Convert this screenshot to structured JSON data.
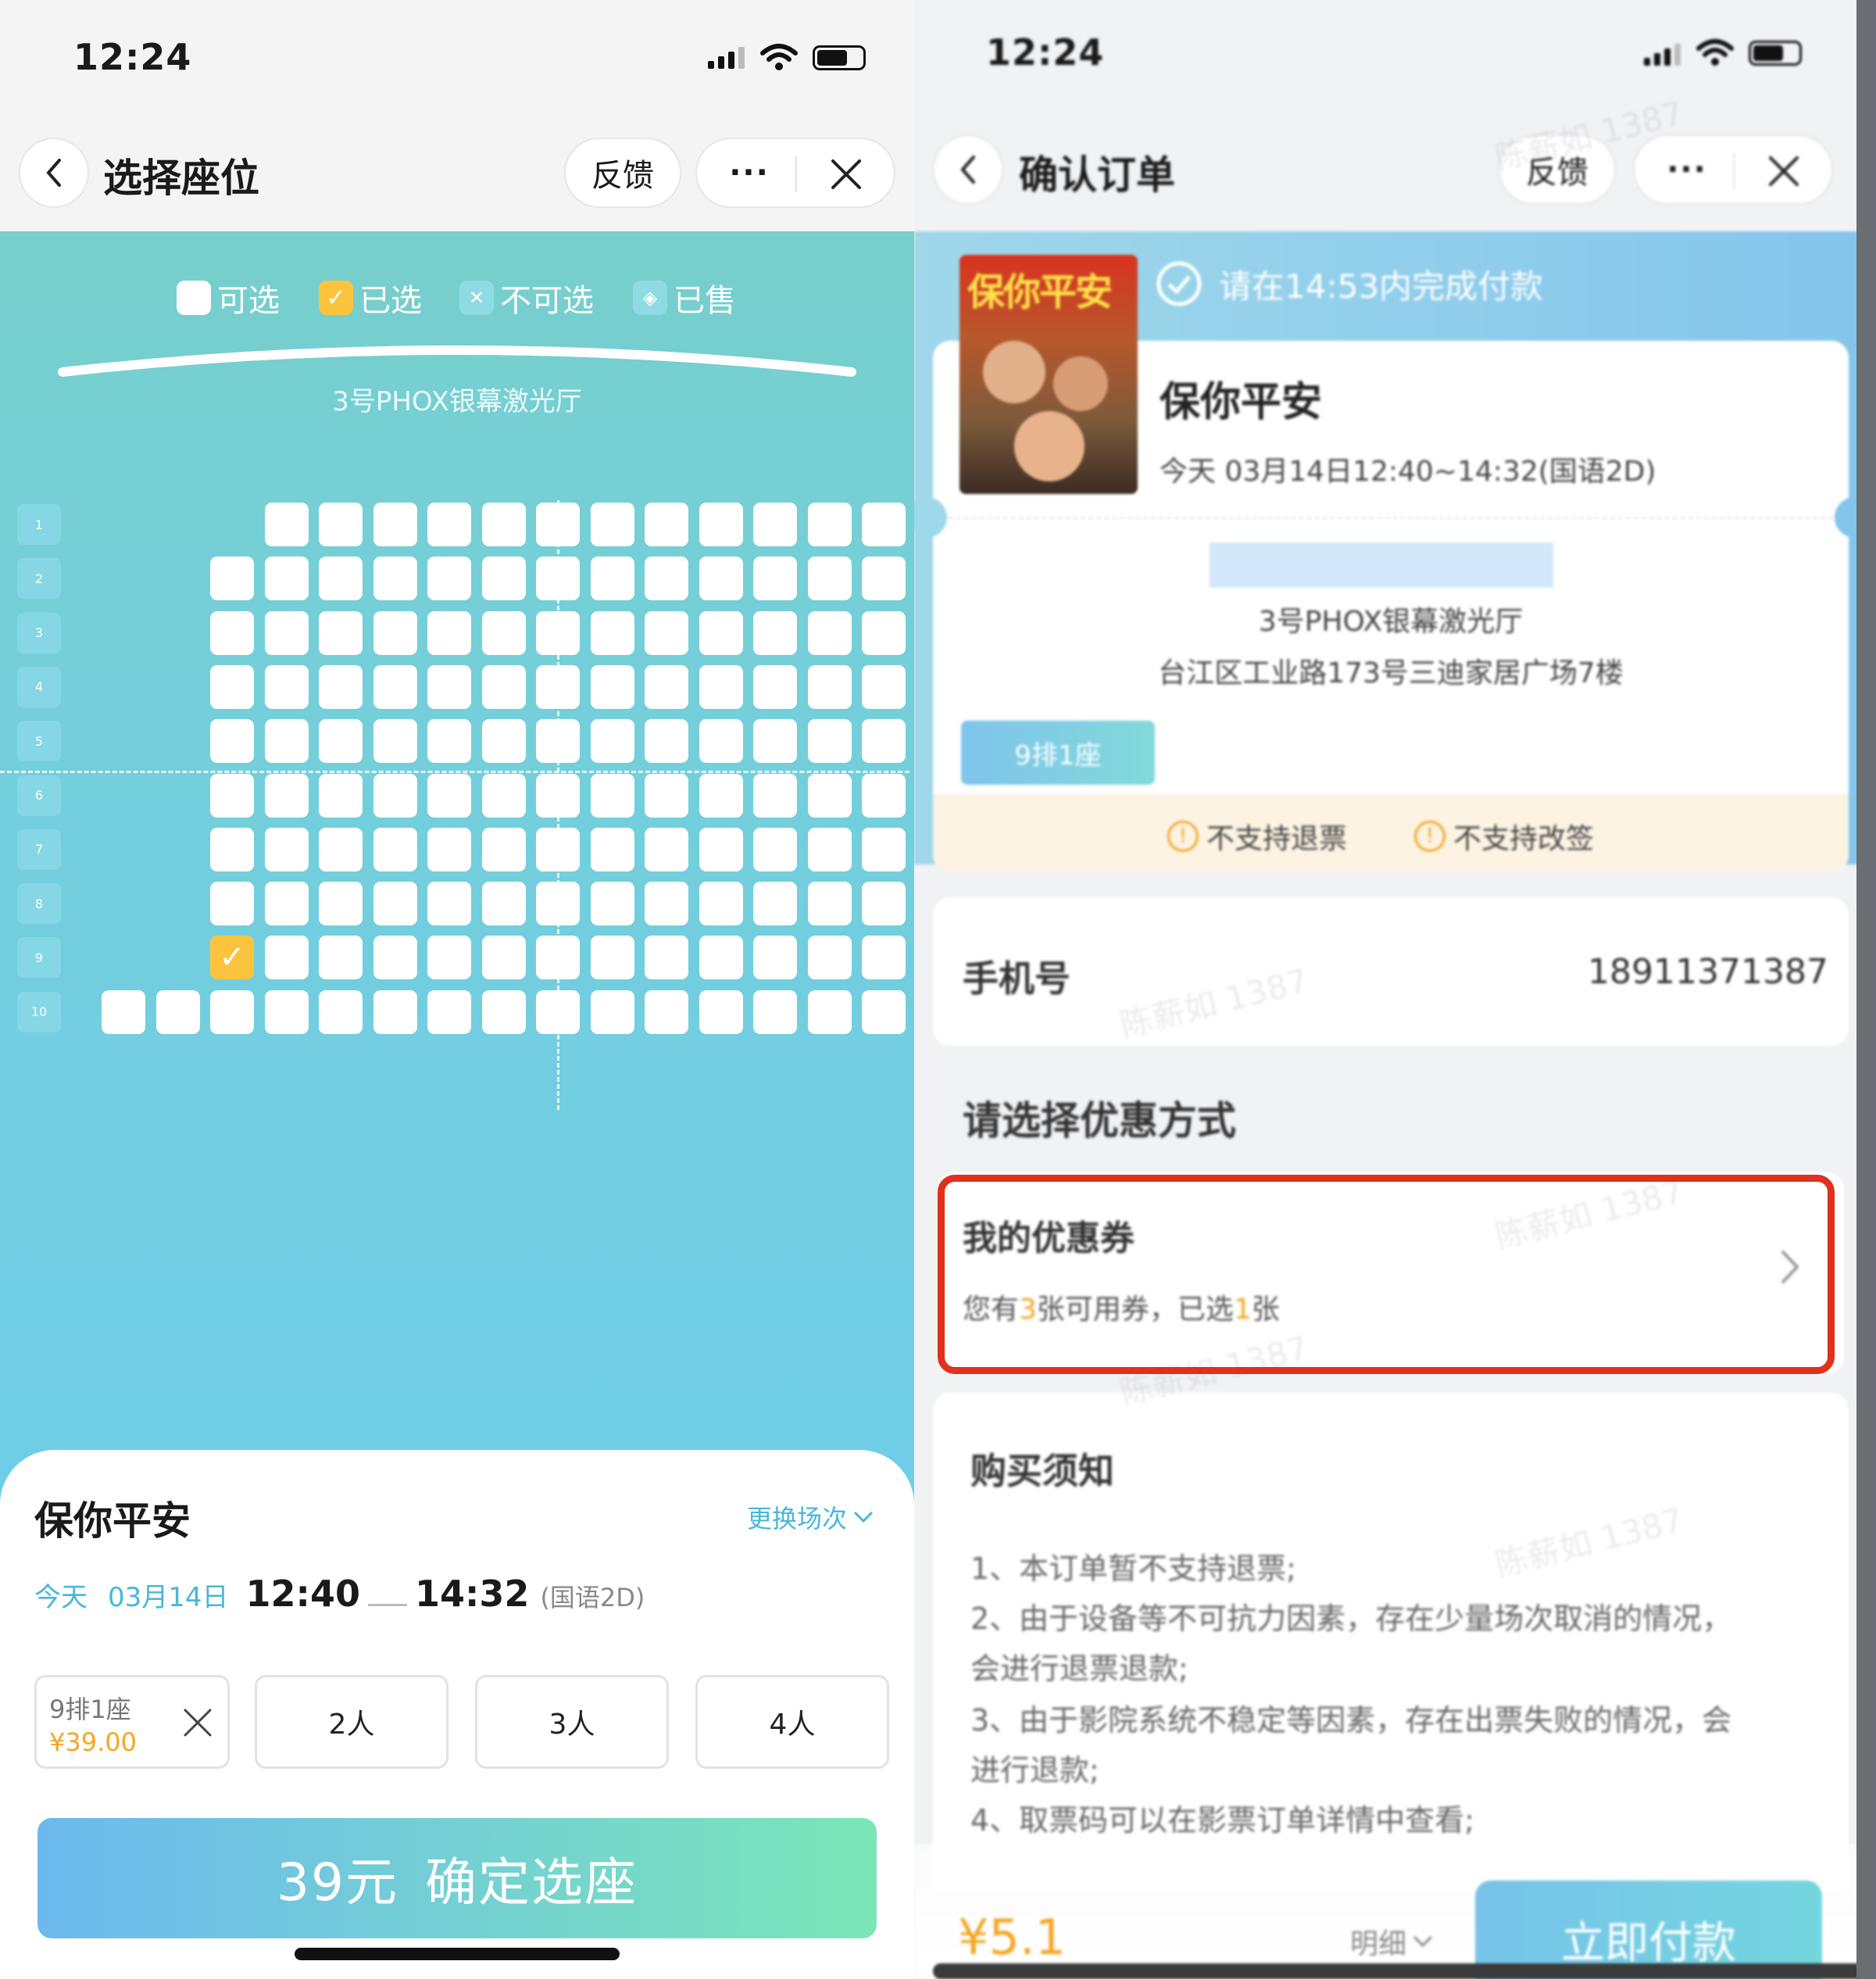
{
  "left": {
    "status": {
      "time": "12:24"
    },
    "nav": {
      "title": "选择座位",
      "feedback": "反馈",
      "more": "···"
    },
    "legend": {
      "available": "可选",
      "selected": "已选",
      "unavailable": "不可选",
      "sold": "已售"
    },
    "hall": "3号PHOX银幕激光厅",
    "rows": [
      "1",
      "2",
      "3",
      "4",
      "5",
      "6",
      "7",
      "8",
      "9",
      "10"
    ],
    "seat_map": {
      "columns_total": 15,
      "row_start_column": [
        4,
        3,
        3,
        3,
        3,
        3,
        3,
        3,
        3,
        1
      ],
      "selected": {
        "row": 9,
        "seat": 1
      }
    },
    "movie": {
      "title": "保你平安",
      "change": "更换场次",
      "day": "今天",
      "date": "03月14日",
      "start": "12:40",
      "end": "14:32",
      "format": "(国语2D)"
    },
    "ticket": {
      "seat": "9排1座",
      "price": "¥39.00"
    },
    "counts": [
      "2人",
      "3人",
      "4人"
    ],
    "confirm": {
      "price": "39元",
      "label": "确定选座"
    }
  },
  "right": {
    "status": {
      "time": "12:24"
    },
    "nav": {
      "title": "确认订单",
      "feedback": "反馈",
      "more": "···"
    },
    "pay_deadline": "请在14:53内完成付款",
    "poster_text": "保你平安",
    "movie": {
      "title": "保你平安",
      "showtime": "今天 03月14日12:40~14:32(国语2D)"
    },
    "hall": "3号PHOX银幕激光厅",
    "address": "台江区工业路173号三迪家居广场7楼",
    "seat_tag": "9排1座",
    "no_refund": "不支持退票",
    "no_change": "不支持改签",
    "phone": {
      "label": "手机号",
      "value": "18911371387"
    },
    "discount_title": "请选择优惠方式",
    "coupon": {
      "title": "我的优惠券",
      "pre": "您有",
      "count": "3",
      "mid": "张可用券，已选",
      "selected": "1",
      "post": "张"
    },
    "notice": {
      "title": "购买须知",
      "lines": [
        "1、本订单暂不支持退票;",
        "2、由于设备等不可抗力因素，存在少量场次取消的情况，",
        "会进行退票退款;",
        "3、由于影院系统不稳定等因素，存在出票失败的情况，会",
        "进行退款;",
        "4、取票码可以在影票订单详情中查看;"
      ]
    },
    "footer": {
      "price": "¥5.1",
      "detail": "明细",
      "pay": "立即付款"
    },
    "watermark": "陈薪如 1387"
  },
  "colors": {
    "accent_teal": "#74cfda",
    "seat_selected": "#fcc43d",
    "coupon_highlight": "#e0301e",
    "price_orange": "#f5a623"
  }
}
